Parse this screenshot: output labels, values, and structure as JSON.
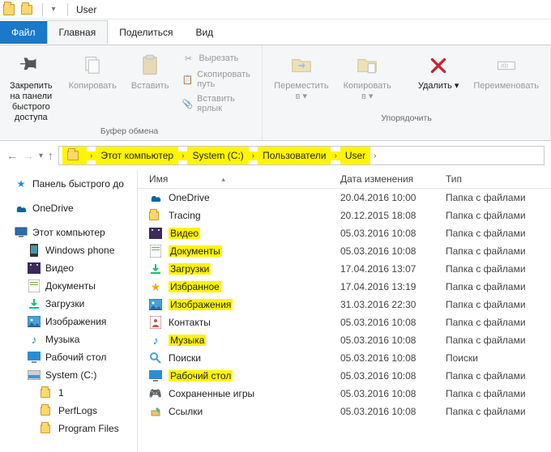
{
  "title_bar": {
    "app_title": "User"
  },
  "menu": {
    "file": "Файл",
    "home": "Главная",
    "share": "Поделиться",
    "view": "Вид"
  },
  "ribbon": {
    "pin_label": "Закрепить на панели\nбыстрого доступа",
    "copy_label": "Копировать",
    "paste_label": "Вставить",
    "cut_label": "Вырезать",
    "copy_path_label": "Скопировать путь",
    "paste_shortcut_label": "Вставить ярлык",
    "group_clipboard": "Буфер обмена",
    "move_to_label": "Переместить\nв ▾",
    "copy_to_label": "Копировать\nв ▾",
    "delete_label": "Удалить",
    "rename_label": "Переименовать",
    "group_organize": "Упорядочить"
  },
  "breadcrumb": {
    "items": [
      "Этот компьютер",
      "System (C:)",
      "Пользователи",
      "User"
    ]
  },
  "columns": {
    "name": "Имя",
    "date": "Дата изменения",
    "type": "Тип"
  },
  "sidebar": {
    "quick_access": "Панель быстрого до",
    "onedrive": "OneDrive",
    "this_pc": "Этот компьютер",
    "items": [
      "Windows phone",
      "Видео",
      "Документы",
      "Загрузки",
      "Изображения",
      "Музыка",
      "Рабочий стол",
      "System (C:)"
    ],
    "drive_items": [
      "1",
      "PerfLogs",
      "Program Files"
    ]
  },
  "rows": [
    {
      "name": "OneDrive",
      "date": "20.04.2016 10:00",
      "type": "Папка с файлами",
      "hi": false,
      "icon": "onedrive"
    },
    {
      "name": "Tracing",
      "date": "20.12.2015 18:08",
      "type": "Папка с файлами",
      "hi": false,
      "icon": "folder"
    },
    {
      "name": "Видео",
      "date": "05.03.2016 10:08",
      "type": "Папка с файлами",
      "hi": true,
      "icon": "video"
    },
    {
      "name": "Документы",
      "date": "05.03.2016 10:08",
      "type": "Папка с файлами",
      "hi": true,
      "icon": "doc"
    },
    {
      "name": "Загрузки",
      "date": "17.04.2016 13:07",
      "type": "Папка с файлами",
      "hi": true,
      "icon": "download"
    },
    {
      "name": "Избранное",
      "date": "17.04.2016 13:19",
      "type": "Папка с файлами",
      "hi": true,
      "icon": "star"
    },
    {
      "name": "Изображения",
      "date": "31.03.2016 22:30",
      "type": "Папка с файлами",
      "hi": true,
      "icon": "image"
    },
    {
      "name": "Контакты",
      "date": "05.03.2016 10:08",
      "type": "Папка с файлами",
      "hi": false,
      "icon": "contact"
    },
    {
      "name": "Музыка",
      "date": "05.03.2016 10:08",
      "type": "Папка с файлами",
      "hi": true,
      "icon": "music"
    },
    {
      "name": "Поиски",
      "date": "05.03.2016 10:08",
      "type": "Поиски",
      "hi": false,
      "icon": "search"
    },
    {
      "name": "Рабочий стол",
      "date": "05.03.2016 10:08",
      "type": "Папка с файлами",
      "hi": true,
      "icon": "desktop"
    },
    {
      "name": "Сохраненные игры",
      "date": "05.03.2016 10:08",
      "type": "Папка с файлами",
      "hi": false,
      "icon": "game"
    },
    {
      "name": "Ссылки",
      "date": "05.03.2016 10:08",
      "type": "Папка с файлами",
      "hi": false,
      "icon": "link"
    }
  ]
}
